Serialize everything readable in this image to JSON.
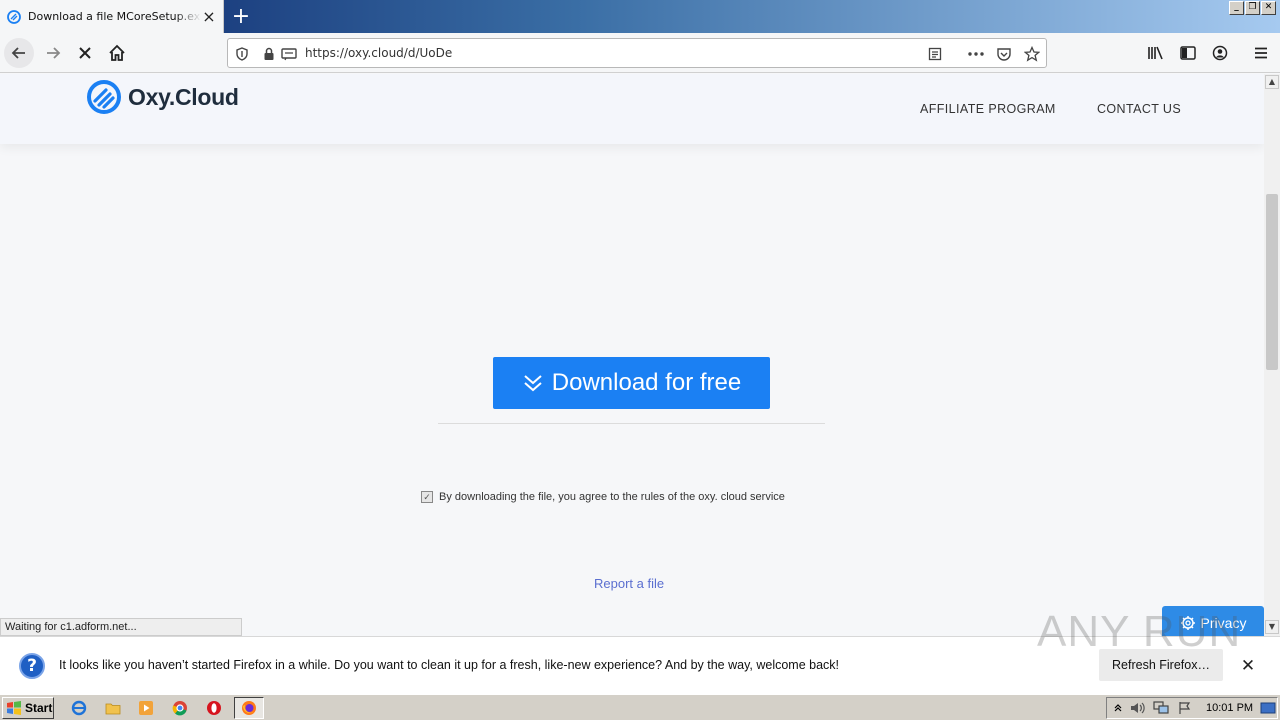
{
  "browser": {
    "tab_title": "Download a file MCoreSetup.exe on oxy.cloud",
    "new_tab_label": "+",
    "url": "https://oxy.cloud/d/UoDe",
    "window_buttons": [
      "_",
      "❐",
      "✕"
    ]
  },
  "site": {
    "logo_text": "Oxy.Cloud",
    "nav": [
      "AFFILIATE PROGRAM",
      "CONTACT US"
    ],
    "download_label": "Download for free",
    "agree_text": "By downloading the file, you agree to the rules of the oxy. cloud service",
    "agree_checked": true,
    "report_label": "Report a file",
    "privacy_label": "Privacy",
    "accent_color": "#1b80f3"
  },
  "status_bar": "Waiting for c1.adform.net...",
  "notification": {
    "text": "It looks like you haven’t started Firefox in a while. Do you want to clean it up for a fresh, like-new experience? And by the way, welcome back!",
    "button": "Refresh Firefox…"
  },
  "watermark": "ANY RUN",
  "taskbar": {
    "start_label": "Start",
    "clock": "10:01 PM"
  }
}
